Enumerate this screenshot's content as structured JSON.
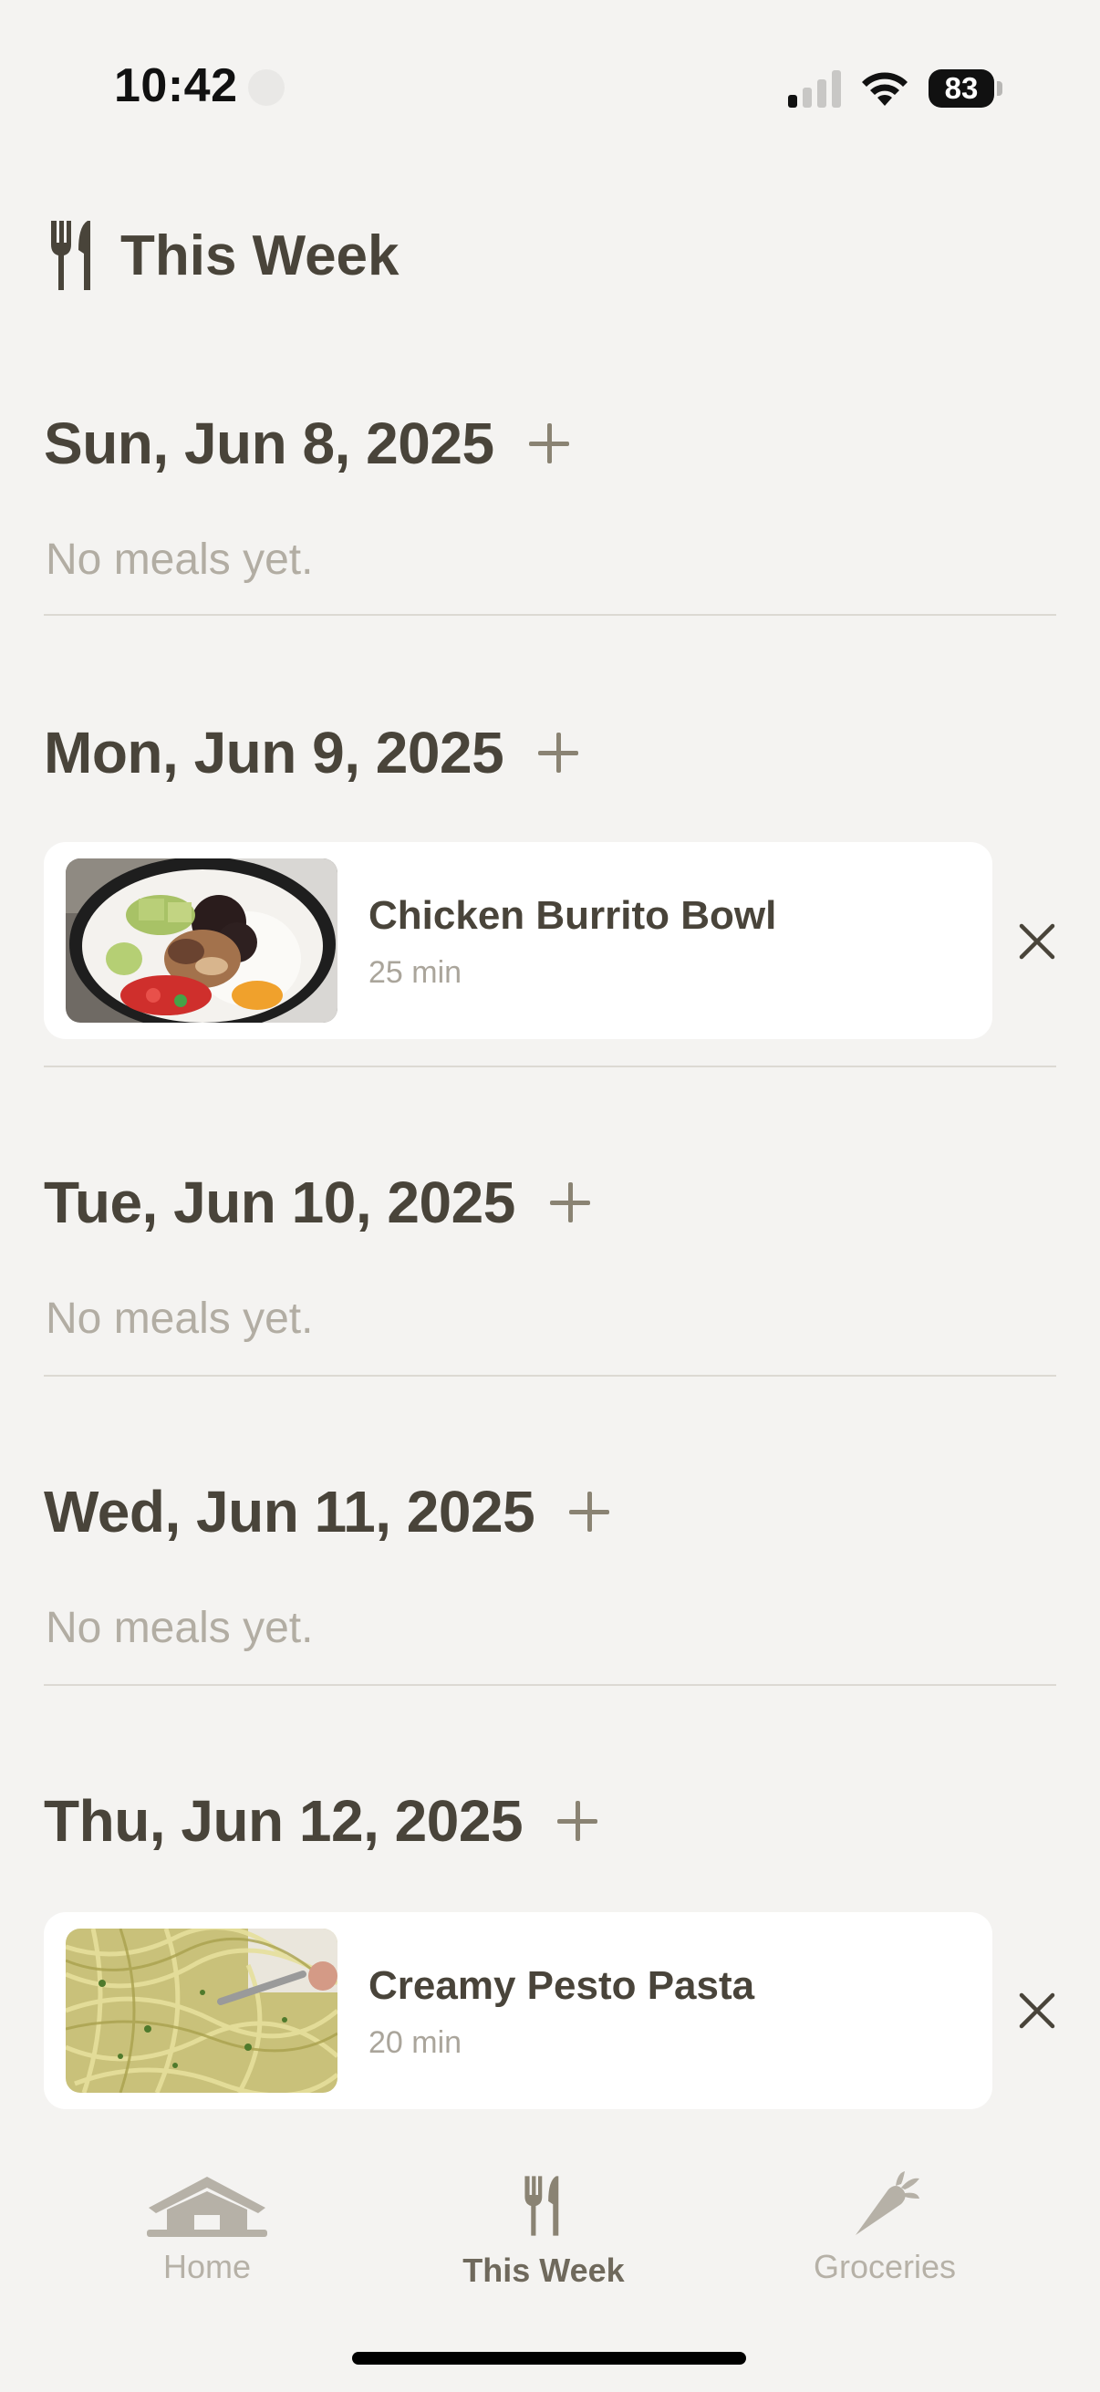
{
  "status_bar": {
    "time": "10:42",
    "battery": "83"
  },
  "header": {
    "title": "This Week",
    "icon": "fork-knife-icon"
  },
  "days": [
    {
      "date": "Sun, Jun 8, 2025",
      "empty_text": "No meals yet."
    },
    {
      "date": "Mon, Jun 9, 2025",
      "meal": {
        "name": "Chicken Burrito Bowl",
        "time": "25 min"
      }
    },
    {
      "date": "Tue, Jun 10, 2025",
      "empty_text": "No meals yet."
    },
    {
      "date": "Wed, Jun 11, 2025",
      "empty_text": "No meals yet."
    },
    {
      "date": "Thu, Jun 12, 2025",
      "meal": {
        "name": "Creamy Pesto Pasta",
        "time": "20 min"
      }
    }
  ],
  "tabs": [
    {
      "label": "Home",
      "icon": "home-icon",
      "active": false
    },
    {
      "label": "This Week",
      "icon": "fork-knife-icon",
      "active": true
    },
    {
      "label": "Groceries",
      "icon": "carrot-icon",
      "active": false
    }
  ],
  "colors": {
    "background": "#f4f3f1",
    "text": "#49443a",
    "muted": "#b2ada3",
    "accent": "#8a8373",
    "inactive_tab": "#b6b1a7"
  }
}
